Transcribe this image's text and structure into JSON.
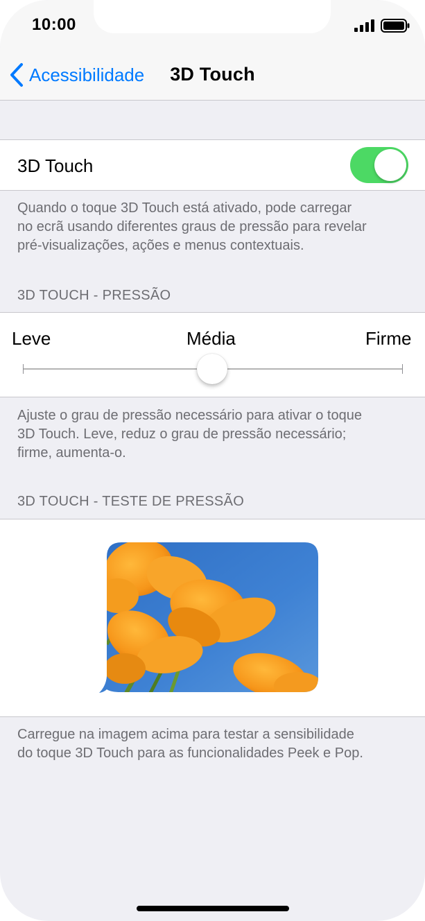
{
  "status_bar": {
    "time": "10:00",
    "signal_icon": "cellular-signal-icon",
    "battery_icon": "battery-icon"
  },
  "nav": {
    "back_label": "Acessibilidade",
    "title": "3D Touch"
  },
  "toggle_cell": {
    "label": "3D Touch",
    "switch_on": true,
    "on_color": "#4cd964"
  },
  "toggle_footer": {
    "line1": "Quando o toque 3D Touch está ativado, pode carregar",
    "line2": "no ecrã usando diferentes graus de pressão para revelar",
    "line3": "pré-visualizações, ações e menus contextuais."
  },
  "pressure_section": {
    "header": "3D TOUCH - PRESSÃO",
    "labels": {
      "left": "Leve",
      "middle": "Média",
      "right": "Firme"
    },
    "slider_value": 0.5
  },
  "pressure_footer": {
    "line1": "Ajuste o grau de pressão necessário para ativar o toque",
    "line2": "3D Touch. Leve, reduz o grau de pressão necessário;",
    "line3": "firme, aumenta-o."
  },
  "test_section": {
    "header": "3D TOUCH - TESTE DE PRESSÃO",
    "image_subject": "orange-poppy-flowers-photo"
  },
  "test_footer": {
    "line1": "Carregue na imagem acima para testar a sensibilidade",
    "line2": "do toque 3D Touch para as funcionalidades Peek e Pop."
  },
  "colors": {
    "accent": "#007aff",
    "group_background": "#efeff4",
    "footer_text": "#6d6d72"
  }
}
